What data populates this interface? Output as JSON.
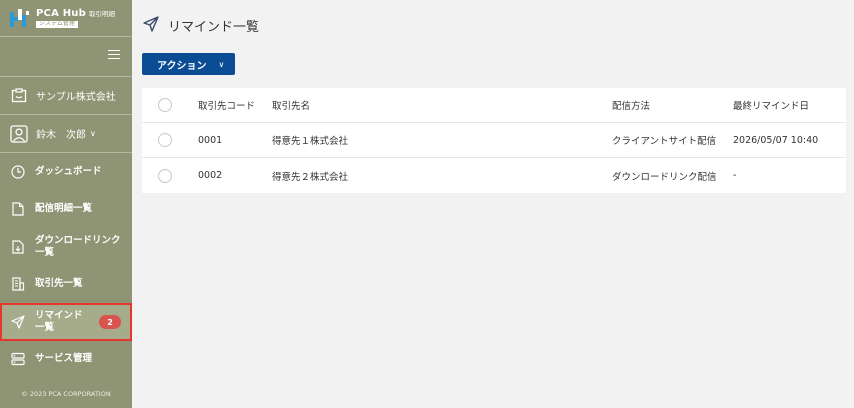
{
  "brand": {
    "name": "PCA Hub",
    "sub": "取引明細",
    "badge": "システム管理"
  },
  "company": {
    "name": "サンプル株式会社"
  },
  "user": {
    "name": "鈴木　次郎",
    "chevron": "∨"
  },
  "nav": [
    {
      "label": "ダッシュボード",
      "icon": "dashboard-icon"
    },
    {
      "label": "配信明細一覧",
      "icon": "document-icon"
    },
    {
      "label": "ダウンロードリンク一覧",
      "icon": "download-link-icon"
    },
    {
      "label": "取引先一覧",
      "icon": "building-icon"
    },
    {
      "label": "リマインド一覧",
      "icon": "send-icon",
      "active": true,
      "badge": "2"
    },
    {
      "label": "サービス管理",
      "icon": "server-icon"
    }
  ],
  "copyright": "© 2023 PCA CORPORATION",
  "page": {
    "title": "リマインド一覧"
  },
  "action_button": {
    "label": "アクション",
    "chevron": "∨"
  },
  "table": {
    "headers": {
      "code": "取引先コード",
      "name": "取引先名",
      "method": "配信方法",
      "date": "最終リマインド日"
    },
    "rows": [
      {
        "code": "0001",
        "name": "得意先１株式会社",
        "method": "クライアントサイト配信",
        "date": "2026/05/07 10:40"
      },
      {
        "code": "0002",
        "name": "得意先２株式会社",
        "method": "ダウンロードリンク配信",
        "date": "-"
      }
    ]
  },
  "colors": {
    "sidebar": "#8e9474",
    "active_item": "#a5ab8b",
    "active_outline": "#e8352d",
    "primary": "#0b4d95",
    "badge": "#d9534f"
  }
}
